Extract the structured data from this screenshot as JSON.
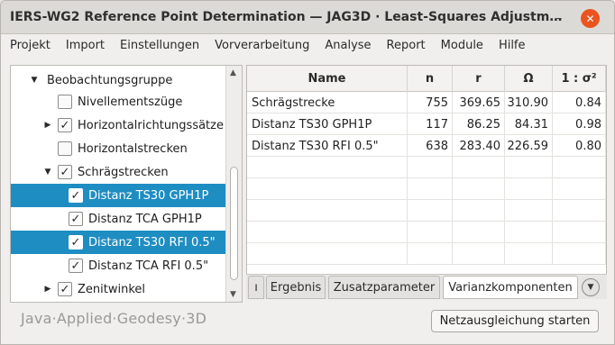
{
  "window": {
    "title": "IERS-WG2 Reference Point Determination — JAG3D · Least-Squares Adjustm…",
    "minimize_glyph": "–",
    "close_glyph": "✕"
  },
  "menu": [
    "Projekt",
    "Import",
    "Einstellungen",
    "Vorverarbeitung",
    "Analyse",
    "Report",
    "Module",
    "Hilfe"
  ],
  "tree": {
    "items": [
      {
        "label": "Beobachtungsgruppe",
        "expanded": true,
        "checkbox": false,
        "checked": false,
        "selected": false
      },
      {
        "label": "Nivellementszüge",
        "checkbox": true,
        "checked": false,
        "selected": false
      },
      {
        "label": "Horizontalrichtungssätze",
        "collapsed": true,
        "checkbox": true,
        "checked": true,
        "selected": false
      },
      {
        "label": "Horizontalstrecken",
        "checkbox": true,
        "checked": false,
        "selected": false
      },
      {
        "label": "Schrägstrecken",
        "expanded": true,
        "checkbox": true,
        "checked": true,
        "selected": false
      },
      {
        "label": "Distanz TS30 GPH1P",
        "checkbox": true,
        "checked": true,
        "selected": true
      },
      {
        "label": "Distanz TCA GPH1P",
        "checkbox": true,
        "checked": true,
        "selected": false
      },
      {
        "label": "Distanz TS30 RFI 0.5\"",
        "checkbox": true,
        "checked": true,
        "selected": true
      },
      {
        "label": "Distanz TCA RFI 0.5\"",
        "checkbox": true,
        "checked": true,
        "selected": false
      },
      {
        "label": "Zenitwinkel",
        "collapsed": true,
        "checkbox": true,
        "checked": true,
        "selected": false
      }
    ],
    "check_glyph": "✓",
    "arrow_down": "▼",
    "arrow_right": "▶"
  },
  "scrollbar": {
    "up": "▲",
    "down": "▼"
  },
  "table": {
    "columns": [
      "Name",
      "n",
      "r",
      "Ω",
      "1 : σ²"
    ],
    "rows": [
      [
        "Schrägstrecke",
        "755",
        "369.65",
        "310.90",
        "0.84"
      ],
      [
        "Distanz TS30 GPH1P",
        "117",
        "86.25",
        "84.31",
        "0.98"
      ],
      [
        "Distanz TS30 RFI 0.5\"",
        "638",
        "283.40",
        "226.59",
        "0.80"
      ]
    ]
  },
  "tabs": {
    "items": [
      "ı",
      "Ergebnis",
      "Zusatzparameter",
      "Varianzkomponenten"
    ],
    "active": "Varianzkomponenten",
    "menu_glyph": "▼"
  },
  "footer": {
    "brand": "Java·Applied·Geodesy·3D",
    "start_button": "Netzausgleichung starten"
  }
}
